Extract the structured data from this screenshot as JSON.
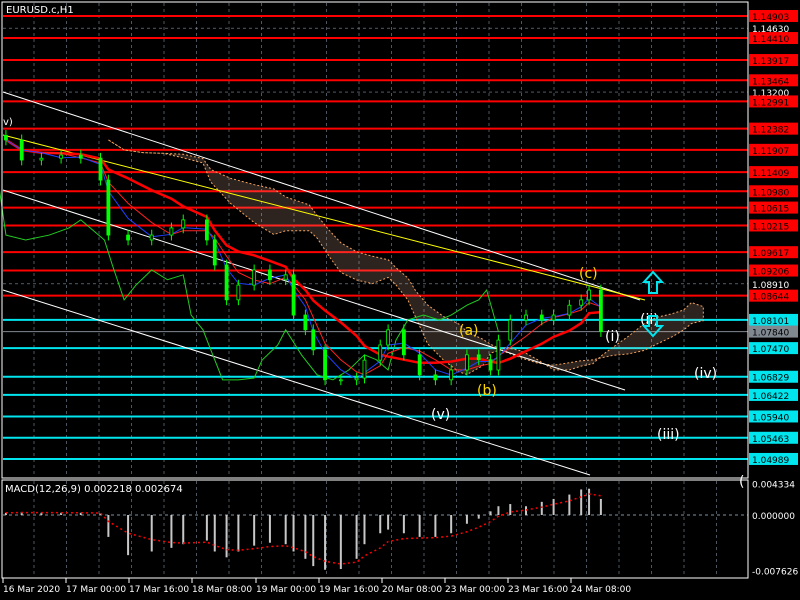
{
  "chart_data": {
    "type": "line",
    "title": "EURUSD.c,H1",
    "symbol": "EURUSD.c",
    "timeframe": "H1",
    "x_tick_labels": [
      "16 Mar 2020",
      "17 Mar 00:00",
      "17 Mar 16:00",
      "18 Mar 08:00",
      "19 Mar 00:00",
      "19 Mar 16:00",
      "20 Mar 08:00",
      "23 Mar 00:00",
      "23 Mar 16:00",
      "24 Mar 08:00"
    ],
    "y_tick_labels": [
      "1.14630",
      "1.13200",
      "1.08910"
    ],
    "ylim": [
      1.0445,
      1.1525
    ],
    "current_price": "1.07840",
    "resistance_levels": [
      "1.14903",
      "1.14410",
      "1.13917",
      "1.13464",
      "1.12991",
      "1.12382",
      "1.11907",
      "1.11409",
      "1.10980",
      "1.10615",
      "1.10215",
      "1.09617",
      "1.09206",
      "1.08644"
    ],
    "support_levels": [
      "1.08101",
      "1.07470",
      "1.06829",
      "1.06422",
      "1.05940",
      "1.05463",
      "1.04989"
    ],
    "price_series": {
      "bar": [
        1,
        5,
        10,
        15,
        20,
        25,
        27,
        32,
        38,
        43,
        46,
        52,
        54,
        57,
        60,
        64,
        68,
        72,
        74,
        77,
        79,
        82,
        86,
        90,
        92,
        96,
        98,
        102,
        106,
        110,
        114,
        118,
        121,
        124,
        126,
        129,
        133,
        137,
        140,
        144,
        147,
        149,
        152
      ],
      "close": [
        1.1213,
        1.1168,
        1.1172,
        1.1179,
        1.1172,
        1.1123,
        1.1,
        1.0989,
        1.1,
        1.1016,
        1.1034,
        1.0989,
        1.0933,
        1.0855,
        1.0888,
        1.0922,
        1.09,
        1.0911,
        1.0821,
        1.0788,
        1.0743,
        1.0676,
        1.0676,
        1.068,
        1.072,
        1.0754,
        1.0788,
        1.0732,
        1.0687,
        1.0676,
        1.0698,
        1.0732,
        1.0721,
        1.0698,
        1.0765,
        1.081,
        1.0821,
        1.081,
        1.0821,
        1.0843,
        1.0855,
        1.0877,
        1.0784
      ]
    },
    "wave_labels": [
      "v)",
      "(a)",
      "(b)",
      "(c)",
      "(v)",
      "(i)",
      "(ii)",
      "(iii)",
      "(iv)",
      "("
    ],
    "macd": {
      "label": "MACD(12,26,9) 0.002218 0.002674",
      "y_tick_labels": [
        "0.004334",
        "0.000000",
        "-0.007626"
      ],
      "ylim": [
        -0.007626,
        0.004334
      ],
      "values": [
        0.0003,
        0.0004,
        0.0003,
        0.0003,
        0.0003,
        0.0002,
        -0.003,
        -0.0055,
        -0.005,
        -0.0045,
        -0.004,
        -0.0035,
        -0.005,
        -0.0058,
        -0.005,
        -0.0042,
        -0.0038,
        -0.004,
        -0.005,
        -0.006,
        -0.007,
        -0.0075,
        -0.0074,
        -0.006,
        -0.004,
        -0.0025,
        -0.002,
        -0.0025,
        -0.003,
        -0.003,
        -0.0025,
        -0.0012,
        -0.0005,
        0.0005,
        0.0012,
        0.0015,
        0.0012,
        0.0018,
        0.0022,
        0.0028,
        0.0035,
        0.0036,
        0.0022
      ]
    },
    "colors": {
      "resistance": "#ff0000",
      "support": "#00e5ee",
      "candle": "#00ff00",
      "current": "#808890",
      "grid": "#8090a0"
    }
  }
}
